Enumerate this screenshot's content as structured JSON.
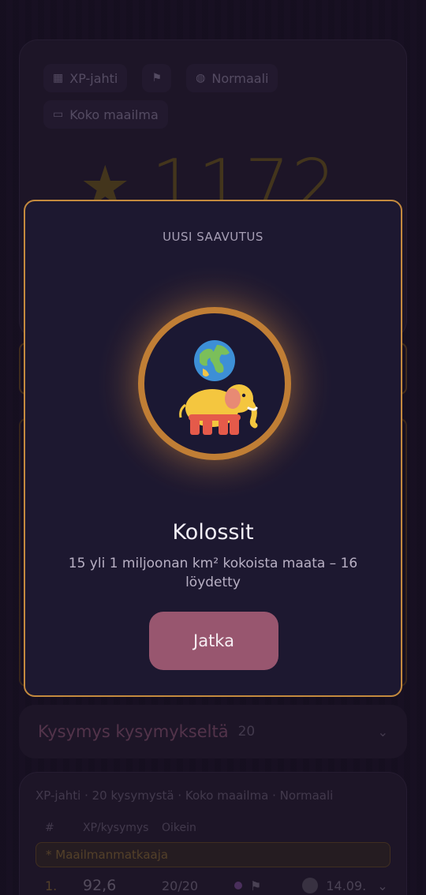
{
  "results": {
    "chips": [
      {
        "icon": "calculator-icon",
        "glyph": "▦",
        "label": "XP-jahti"
      },
      {
        "icon": "flag-icon",
        "glyph": "⚑",
        "label": ""
      },
      {
        "icon": "globe-icon",
        "glyph": "◍",
        "label": "Normaali"
      },
      {
        "icon": "map-icon",
        "glyph": "▭",
        "label": "Koko maailma"
      }
    ],
    "score": "1172"
  },
  "accordion": {
    "title": "Kysymys kysymykseltä",
    "count": "20"
  },
  "history": {
    "header": "XP-jahti · 20 kysymystä · Koko maailma · Normaali",
    "columns": [
      "#",
      "XP/kysymys",
      "Oikein"
    ],
    "badge": "*  Maailmanmatkaaja",
    "rows": [
      {
        "rank": "1.",
        "xp": "92,6",
        "correct": "20/20",
        "date": "14.09."
      }
    ]
  },
  "modal": {
    "kicker": "UUSI SAAVUTUS",
    "badge_icon": "elephant-globe-icon",
    "title": "Kolossit",
    "description": "15 yli 1 miljoonan km² kokoista maata – 16 löydetty",
    "button": "Jatka"
  },
  "colors": {
    "accent_gold": "#c48a3e",
    "button": "#98566f",
    "modal_bg": "#1d1830"
  }
}
